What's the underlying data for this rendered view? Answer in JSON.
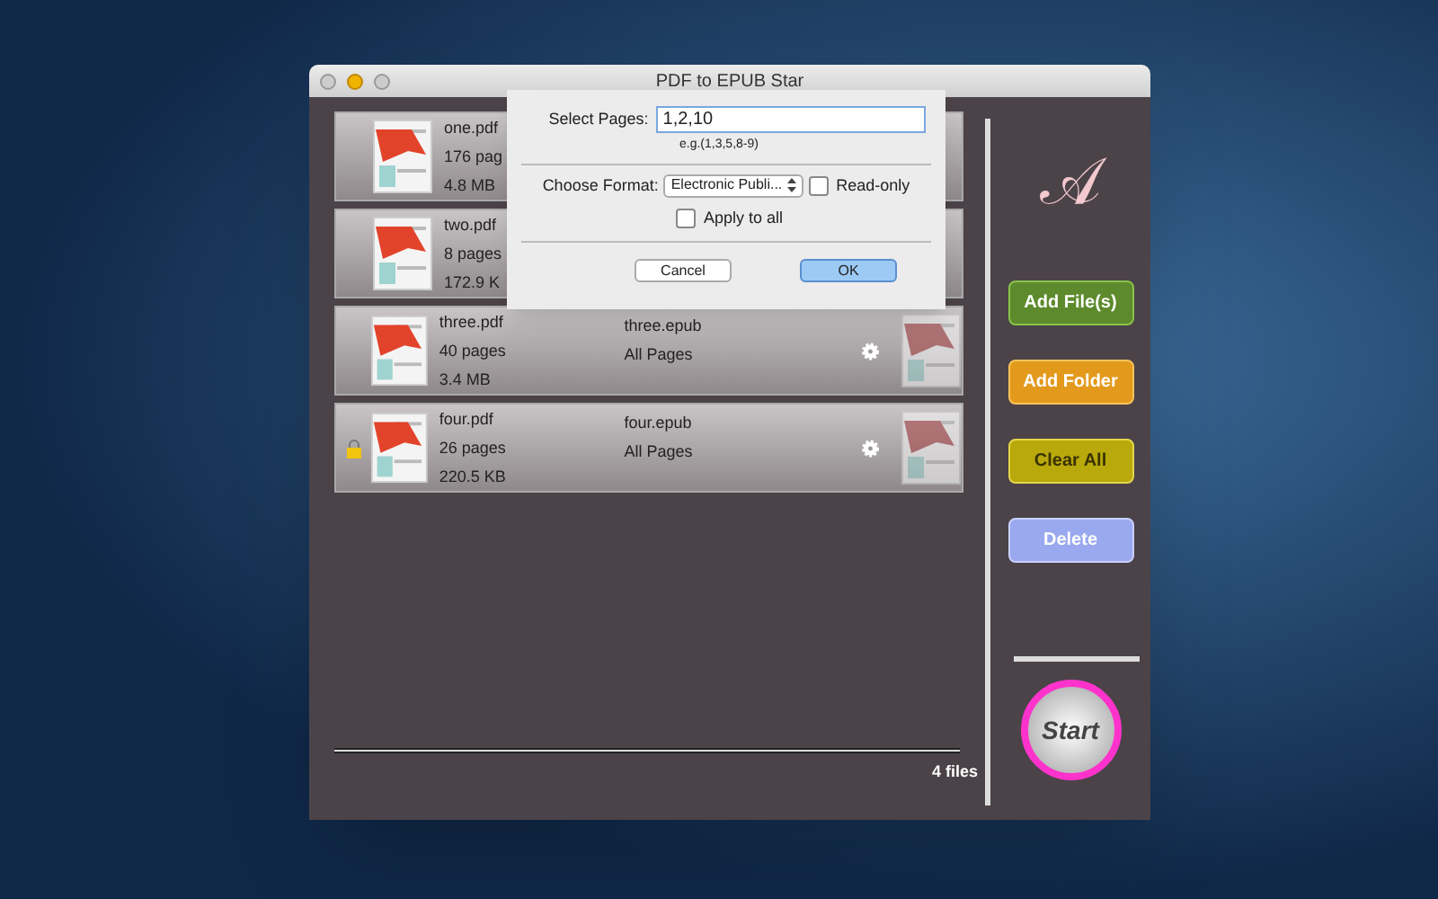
{
  "window": {
    "title": "PDF to EPUB Star"
  },
  "files": [
    {
      "name": "one.pdf",
      "pages": "176 pag",
      "size": "4.8 MB",
      "locked": false
    },
    {
      "name": "two.pdf",
      "pages": "8 pages",
      "size": "172.9 K",
      "locked": false
    },
    {
      "name": "three.pdf",
      "pages": "40 pages",
      "size": "3.4 MB",
      "output": "three.epub",
      "range": "All Pages",
      "locked": false
    },
    {
      "name": "four.pdf",
      "pages": "26 pages",
      "size": "220.5 KB",
      "output": "four.epub",
      "range": "All Pages",
      "locked": true
    }
  ],
  "sheet": {
    "pages_label": "Select Pages:",
    "pages_value": "1,2,10",
    "pages_hint": "e.g.(1,3,5,8-9)",
    "format_label": "Choose Format:",
    "format_value": "Electronic Publi...",
    "read_only": {
      "label": "Read-only",
      "checked": false
    },
    "apply_all": {
      "label": "Apply to all",
      "checked": false
    },
    "buttons": [
      {
        "label": "Cancel",
        "kind": "cancel"
      },
      {
        "label": "OK",
        "kind": "default"
      }
    ]
  },
  "actions": [
    {
      "label": "Add File(s)",
      "kind": "green"
    },
    {
      "label": "Add Folder",
      "kind": "orange"
    },
    {
      "label": "Clear All",
      "kind": "yellow"
    },
    {
      "label": "Delete",
      "kind": "blue"
    }
  ],
  "logo": "𝒜",
  "start": {
    "label": "Start"
  },
  "status": "4 files"
}
